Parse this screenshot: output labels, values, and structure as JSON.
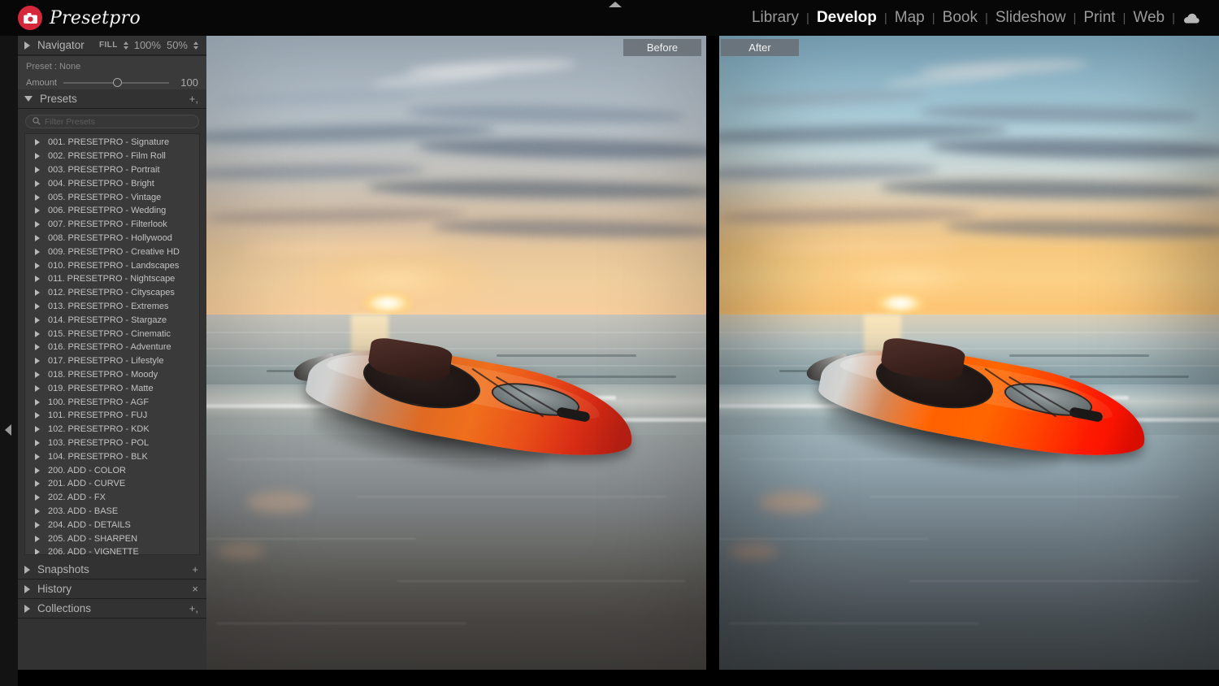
{
  "app": {
    "brand_name": "Presetpro",
    "brand_icon": "camera-icon",
    "cloud_icon": "cloud-icon",
    "accent_color": "#d6283b",
    "panel_bg": "#323232"
  },
  "modules": {
    "items": [
      {
        "label": "Library",
        "active": false
      },
      {
        "label": "Develop",
        "active": true
      },
      {
        "label": "Map",
        "active": false
      },
      {
        "label": "Book",
        "active": false
      },
      {
        "label": "Slideshow",
        "active": false
      },
      {
        "label": "Print",
        "active": false
      },
      {
        "label": "Web",
        "active": false
      }
    ],
    "separator": "|"
  },
  "navigator": {
    "title": "Navigator",
    "zoom_fill": "FILL",
    "zoom_100": "100%",
    "zoom_50": "50%",
    "preset_line": "Preset : None",
    "amount_label": "Amount",
    "amount_value": "100"
  },
  "presets_panel": {
    "title": "Presets",
    "add_icon": "plus-icon",
    "filter_placeholder": "Filter Presets",
    "search_icon": "search-icon",
    "items": [
      "001. PRESETPRO - Signature",
      "002. PRESETPRO - Film Roll",
      "003. PRESETPRO - Portrait",
      "004. PRESETPRO - Bright",
      "005. PRESETPRO - Vintage",
      "006. PRESETPRO - Wedding",
      "007. PRESETPRO - Filterlook",
      "008. PRESETPRO - Hollywood",
      "009. PRESETPRO - Creative HD",
      "010. PRESETPRO - Landscapes",
      "011. PRESETPRO - Nightscape",
      "012. PRESETPRO - Cityscapes",
      "013. PRESETPRO - Extremes",
      "014. PRESETPRO - Stargaze",
      "015. PRESETPRO - Cinematic",
      "016. PRESETPRO - Adventure",
      "017. PRESETPRO - Lifestyle",
      "018. PRESETPRO - Moody",
      "019. PRESETPRO - Matte",
      "100. PRESETPRO - AGF",
      "101. PRESETPRO - FUJ",
      "102. PRESETPRO - KDK",
      "103. PRESETPRO - POL",
      "104. PRESETPRO - BLK",
      "200. ADD - COLOR",
      "201. ADD - CURVE",
      "202. ADD - FX",
      "203. ADD - BASE",
      "204. ADD - DETAILS",
      "205. ADD - SHARPEN",
      "206. ADD - VIGNETTE"
    ]
  },
  "bottom_panels": [
    {
      "title": "Snapshots",
      "action_icon": "plus-icon",
      "action_label": "+"
    },
    {
      "title": "History",
      "action_icon": "close-icon",
      "action_label": "×"
    },
    {
      "title": "Collections",
      "action_icon": "plus-icon",
      "action_label": "+,"
    }
  ],
  "viewer": {
    "before_label": "Before",
    "after_label": "After",
    "subject": "sea kayak on wet beach at sunset"
  }
}
